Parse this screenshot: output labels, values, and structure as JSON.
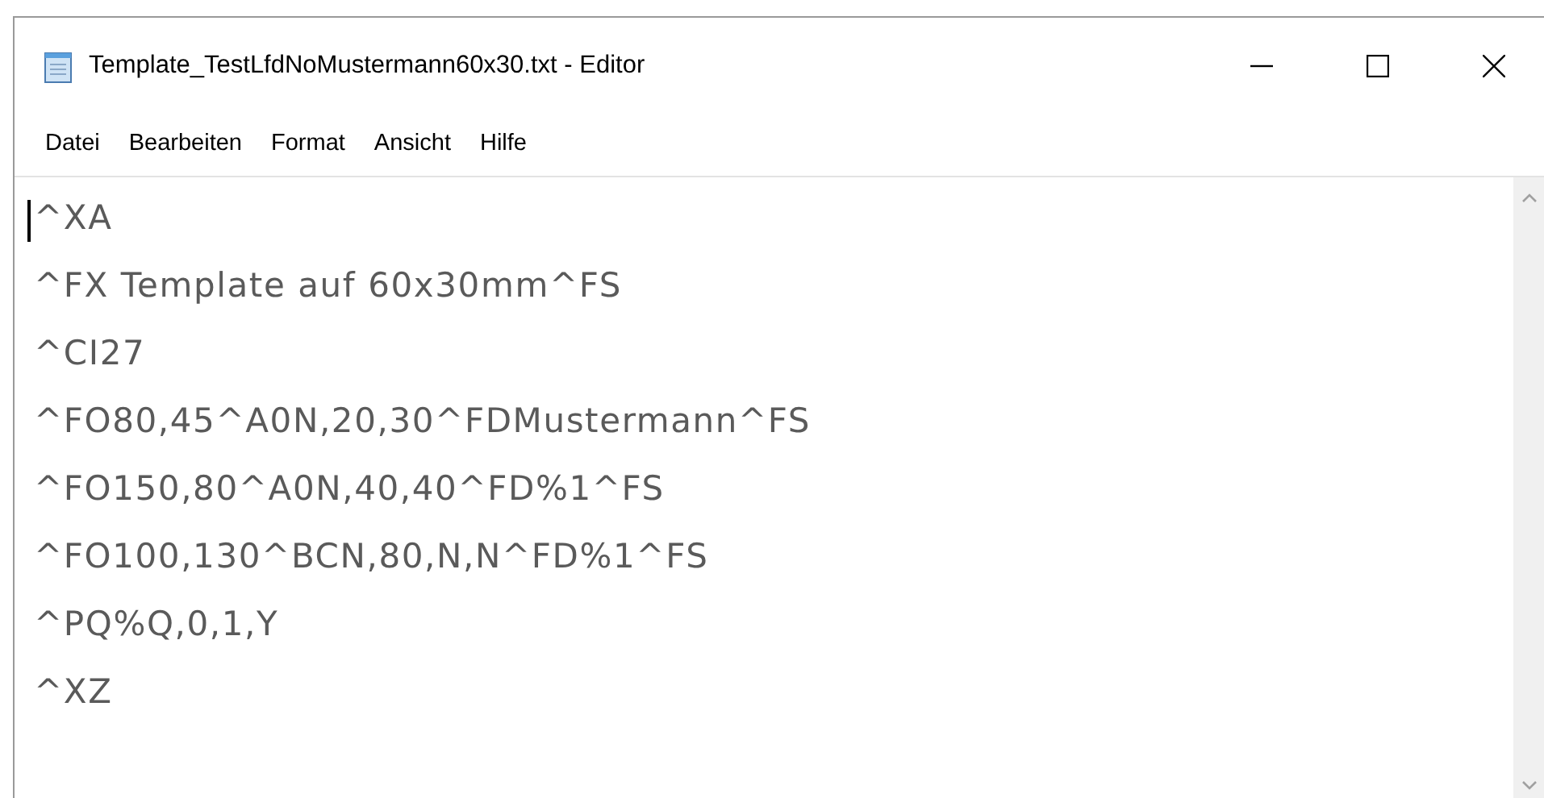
{
  "window": {
    "title": "Template_TestLfdNoMustermann60x30.txt - Editor"
  },
  "menu": [
    "Datei",
    "Bearbeiten",
    "Format",
    "Ansicht",
    "Hilfe"
  ],
  "editor": {
    "lines": [
      "^XA",
      "^FX Template auf 60x30mm^FS",
      "^CI27",
      "^FO80,45^A0N,20,30^FDMustermann^FS",
      "^FO150,80^A0N,40,40^FD%1^FS",
      "^FO100,130^BCN,80,N,N^FD%1^FS",
      "^PQ%Q,0,1,Y",
      "^XZ"
    ]
  }
}
